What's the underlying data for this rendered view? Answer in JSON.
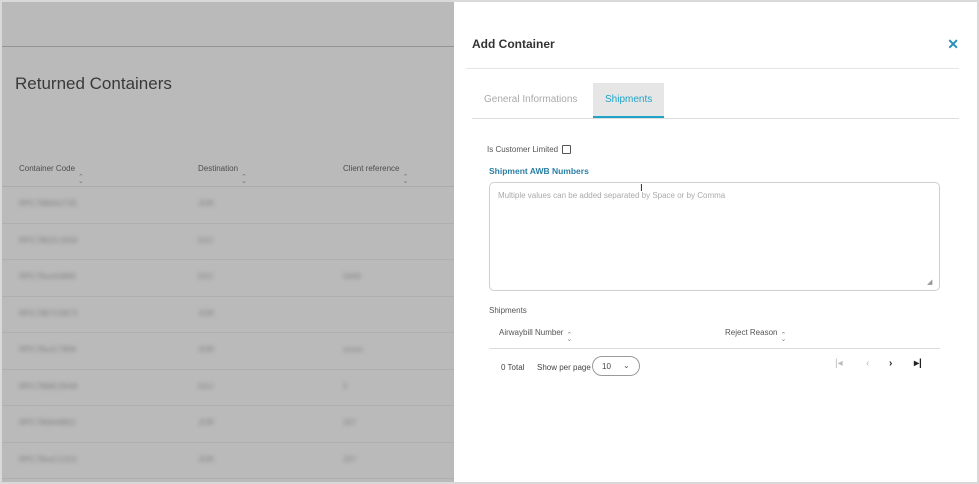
{
  "background": {
    "title": "Returned Containers",
    "columns": [
      "Container Code",
      "Destination",
      "Client reference"
    ],
    "rows": [
      [
        "RPC7866A2735",
        "JOR",
        ""
      ],
      [
        "RPC7802C1559",
        "DXJ",
        ""
      ],
      [
        "RPC78xxA0865",
        "DXJ",
        "5649"
      ],
      [
        "RPC7867C0873",
        "JOR",
        ""
      ],
      [
        "RPC78xxC7806",
        "JOR",
        "xxxxx"
      ],
      [
        "RPC7868C0548",
        "DXJ",
        "5"
      ],
      [
        "RPC7806A8811",
        "JOR",
        "207"
      ],
      [
        "RPC78xxC1313",
        "JOR",
        "207"
      ]
    ]
  },
  "drawer": {
    "title": "Add Container",
    "close_icon": "close-icon",
    "tabs": [
      {
        "label": "General Informations",
        "active": false
      },
      {
        "label": "Shipments",
        "active": true
      }
    ],
    "is_customer_limited": {
      "label": "Is Customer Limited",
      "checked": false
    },
    "awb": {
      "label": "Shipment AWB Numbers",
      "placeholder": "Multiple values can be added separated by Space or by Comma",
      "value": ""
    },
    "shipments": {
      "label": "Shipments",
      "columns": [
        "Airwaybill Number",
        "Reject Reason"
      ],
      "rows": []
    },
    "pagination": {
      "total": "0 Total",
      "show_per_page_label": "Show per page",
      "per_page": "10",
      "icons": [
        "first-page-icon",
        "prev-page-icon",
        "next-page-icon",
        "last-page-icon"
      ]
    }
  },
  "colors": {
    "accent": "#1fa3c8",
    "label_blue": "#2a7fa5",
    "overlay": "#5a5a5a"
  }
}
